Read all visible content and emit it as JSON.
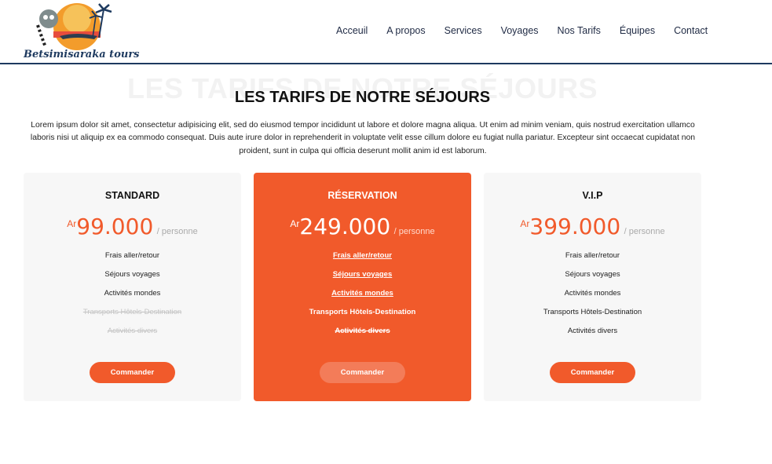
{
  "brand": {
    "name": "Betsimisaraka tours"
  },
  "nav": [
    "Acceuil",
    "A propos",
    "Services",
    "Voyages",
    "Nos Tarifs",
    "Équipes",
    "Contact"
  ],
  "section": {
    "ghost_title": "LES TARIFS DE NOTRE SÉJOURS",
    "title": "LES TARIFS DE NOTRE SÉJOURS",
    "intro": "Lorem ipsum dolor sit amet, consectetur adipisicing elit, sed do eiusmod tempor incididunt ut labore et dolore magna aliqua. Ut enim ad minim veniam, quis nostrud exercitation ullamco laboris nisi ut aliquip ex ea commodo consequat. Duis aute irure dolor in reprehenderit in voluptate velit esse cillum dolore eu fugiat nulla pariatur. Excepteur sint occaecat cupidatat non proident, sunt in culpa qui officia deserunt mollit anim id est laborum."
  },
  "plans": [
    {
      "name": "STANDARD",
      "currency": "Ar",
      "amount": "99.000",
      "per": "/ personne",
      "features": [
        "Frais aller/retour",
        "Séjours voyages",
        "Activités mondes",
        "Transports Hôtels-Destination",
        "Activités divers"
      ],
      "button": "Commander"
    },
    {
      "name": "RÉSERVATION",
      "currency": "Ar",
      "amount": "249.000",
      "per": "/ personne",
      "features": [
        "Frais aller/retour",
        "Séjours voyages",
        "Activités mondes",
        "Transports Hôtels-Destination",
        "Activités divers"
      ],
      "button": "Commander"
    },
    {
      "name": "V.I.P",
      "currency": "Ar",
      "amount": "399.000",
      "per": "/ personne",
      "features": [
        "Frais aller/retour",
        "Séjours voyages",
        "Activités mondes",
        "Transports Hôtels-Destination",
        "Activités divers"
      ],
      "button": "Commander"
    }
  ],
  "colors": {
    "accent": "#f15a2b",
    "navy": "#1e3a5f",
    "card_bg": "#f7f7f7"
  }
}
